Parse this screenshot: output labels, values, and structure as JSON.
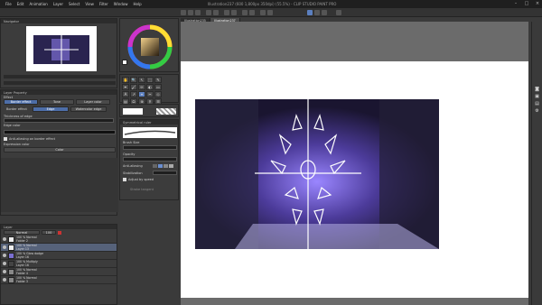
{
  "app": {
    "window_title": "Illustration237 (600 1,800px 350dpi) (55.5%) - CLIP STUDIO PAINT PRO",
    "menu": [
      "File",
      "Edit",
      "Animation",
      "Layer",
      "Select",
      "View",
      "Filter",
      "Window",
      "Help"
    ]
  },
  "tabs": {
    "doc1": "Illustration235",
    "doc2": "Illustration237"
  },
  "navigator": {
    "title": "Navigator"
  },
  "tool_property": {
    "title": "Layer Property",
    "effect_label": "Effect",
    "buttons": [
      "Border effect",
      "Tone",
      "Layer color"
    ],
    "border_effect_label": "Border effect",
    "options": [
      "Edge",
      "Watercolor edge"
    ],
    "thickness_label": "Thickness of edge",
    "edge_color_label": "Edge color",
    "anti_alias_label": "Anti-aliasing on border effect",
    "expression_label": "Expression color",
    "color_value": "Color"
  },
  "sub_tool": {
    "title": "Sub Tool",
    "name": "Symmetrical ruler",
    "brush_size_label": "Brush Size",
    "opacity_label": "Opacity",
    "anti_alias_label": "Anti-aliasing",
    "stabilization_label": "Stabilization",
    "adjust_label": "Adjust by speed",
    "extra": "Stroke tangent"
  },
  "tools": [
    "✋",
    "🔍",
    "↖",
    "⬚",
    "✎",
    "✒",
    "🖌",
    "✏",
    "◐",
    "▭",
    "A",
    "↗",
    "⌖",
    "✂",
    "◇",
    "▤",
    "⬭",
    "⊕",
    "⚲",
    "☰"
  ],
  "layers": {
    "title": "Layer",
    "blend_mode": "Normal",
    "opacity": "100",
    "items": [
      {
        "name": "100 % Normal",
        "sub": "Folder 2"
      },
      {
        "name": "100 % Normal",
        "sub": "Layer 13",
        "selected": true
      },
      {
        "name": "100 % Glow dodge",
        "sub": "Layer 16"
      },
      {
        "name": "100 % Multiply",
        "sub": "Layer 16"
      },
      {
        "name": "100 % Normal",
        "sub": "Folder 4"
      },
      {
        "name": "100 % Normal",
        "sub": "Folder 3"
      }
    ]
  },
  "colors": {
    "accent": "#4d6ea8",
    "panel_bg": "#3c3c3c",
    "canvas_bg": "#6b6b6b",
    "paper": "#ffffff",
    "scene_purple": "#6c5bd0"
  }
}
